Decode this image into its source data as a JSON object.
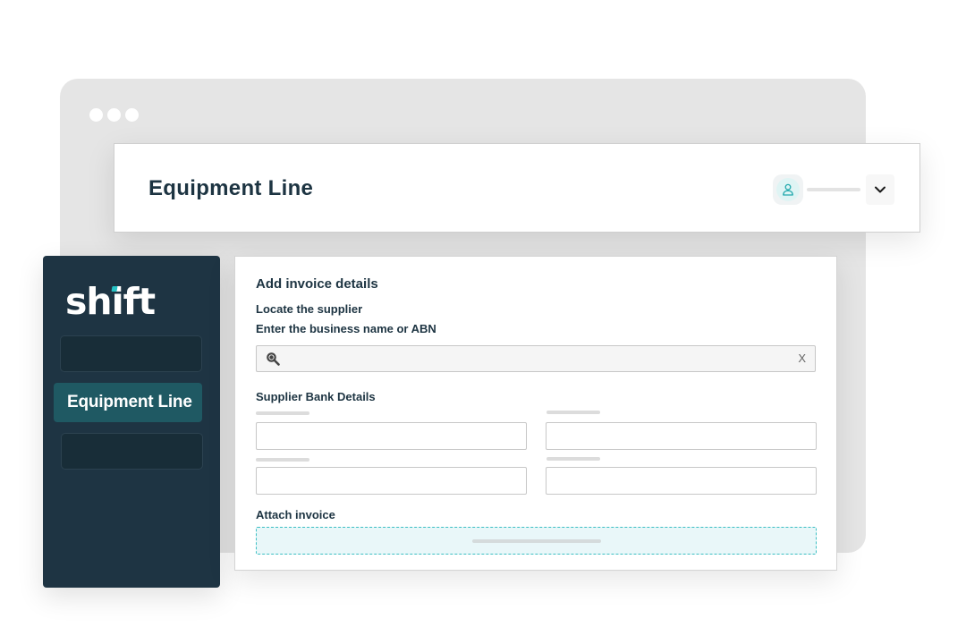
{
  "header": {
    "title": "Equipment Line",
    "user_icon": "user-icon",
    "menu_icon": "chevron-down-icon"
  },
  "sidebar": {
    "logo": "shift",
    "active_item": "Equipment Line"
  },
  "form": {
    "title": "Add invoice details",
    "supplier_label": "Locate the supplier",
    "supplier_hint": "Enter the business name or ABN",
    "search": {
      "value": "",
      "placeholder": "",
      "clear_label": "X",
      "icon": "search-icon"
    },
    "bank_details_label": "Supplier Bank Details",
    "attach_label": "Attach invoice"
  },
  "colors": {
    "sidebar_bg": "#1e3443",
    "active_nav": "#1f5963",
    "accent": "#27c1c4",
    "text_dark": "#1d3442",
    "dropzone_bg": "#e9f7f9"
  }
}
